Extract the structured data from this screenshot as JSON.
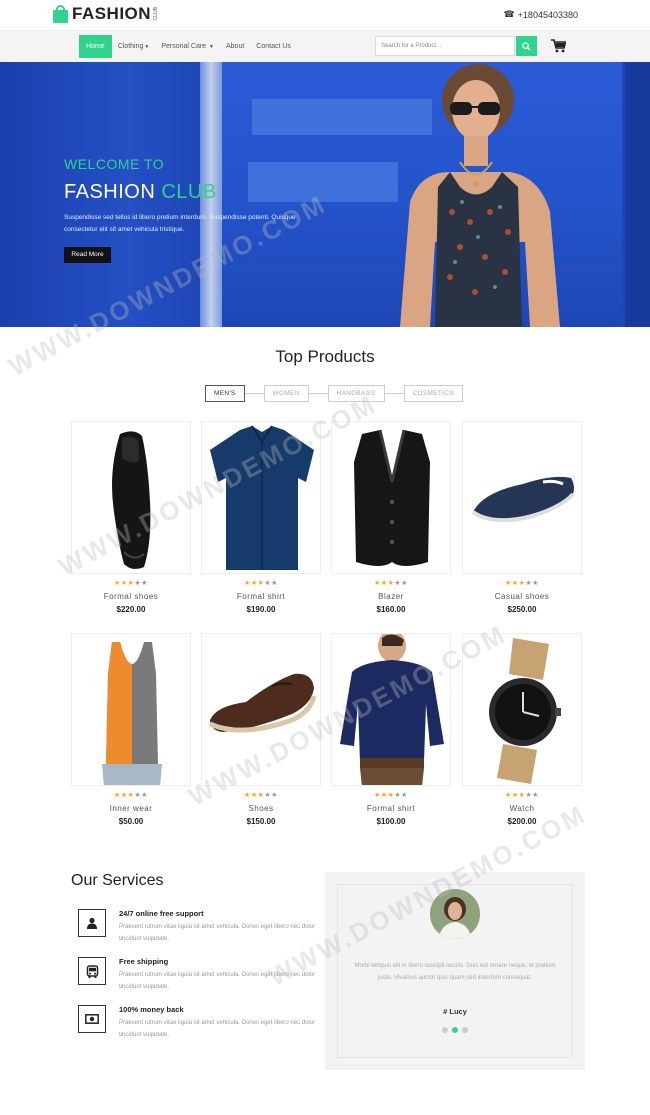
{
  "brand": {
    "name": "FASHION",
    "sub": "CLUB"
  },
  "header": {
    "phone": "+18045403380"
  },
  "nav": {
    "items": [
      {
        "label": "Home"
      },
      {
        "label": "Clothing"
      },
      {
        "label": "Personal Care"
      },
      {
        "label": "About"
      },
      {
        "label": "Contact Us"
      }
    ],
    "search_placeholder": "Search for a Product..."
  },
  "hero": {
    "welcome": "WELCOME TO",
    "title_main": "FASHION ",
    "title_accent": "CLUB",
    "description": "Suspendisse sed tellus id libero pretium interdum. Suspendisse potenti. Quisque consectetur elit sit amet vehicula tristique.",
    "button": "Read More"
  },
  "products_section": {
    "title": "Top Products",
    "tabs": [
      "MEN'S",
      "WOMEN",
      "HANDBAGS",
      "COSMETICS"
    ],
    "items": [
      {
        "name": "Formal shoes",
        "price": "$220.00",
        "rating": 3,
        "icon": "formal-shoes"
      },
      {
        "name": "Formal shirt",
        "price": "$190.00",
        "rating": 3,
        "icon": "blue-shirt"
      },
      {
        "name": "Blazer",
        "price": "$160.00",
        "rating": 3,
        "icon": "vest"
      },
      {
        "name": "Casual shoes",
        "price": "$250.00",
        "rating": 3,
        "icon": "slip-on-shoe"
      },
      {
        "name": "Inner wear",
        "price": "$50.00",
        "rating": 3,
        "icon": "tank-top"
      },
      {
        "name": "Shoes",
        "price": "$150.00",
        "rating": 3,
        "icon": "brown-shoe"
      },
      {
        "name": "Formal shirt",
        "price": "$100.00",
        "rating": 3,
        "icon": "man-shirt"
      },
      {
        "name": "Watch",
        "price": "$200.00",
        "rating": 3,
        "icon": "watch"
      }
    ]
  },
  "services": {
    "title": "Our Services",
    "items": [
      {
        "title": "24/7 online free support",
        "text": "Praesent rutrum vitae ligula sit amet vehicula. Donec eget libero nec dolor tincidunt vulputate.",
        "icon": "user-icon"
      },
      {
        "title": "Free shipping",
        "text": "Praesent rutrum vitae ligula sit amet vehicula. Donec eget libero nec dolor tincidunt vulputate.",
        "icon": "bus-icon"
      },
      {
        "title": "100% money back",
        "text": "Praesent rutrum vitae ligula sit amet vehicula. Donec eget libero nec dolor tincidunt vulputate.",
        "icon": "money-icon"
      }
    ]
  },
  "testimonial": {
    "text": "Morbi tempus elit in libero suscipit iaculis. Duis est ornare neque, et pretium justo. Vivamus auctor quis quam sed interdum consequat.",
    "name": "# Lucy",
    "active_dot": 1
  },
  "watermark": "WWW.DOWNDEMO.COM",
  "colors": {
    "accent": "#2fd38b",
    "hero_blue": "#1f46b8",
    "dark": "#111111"
  }
}
